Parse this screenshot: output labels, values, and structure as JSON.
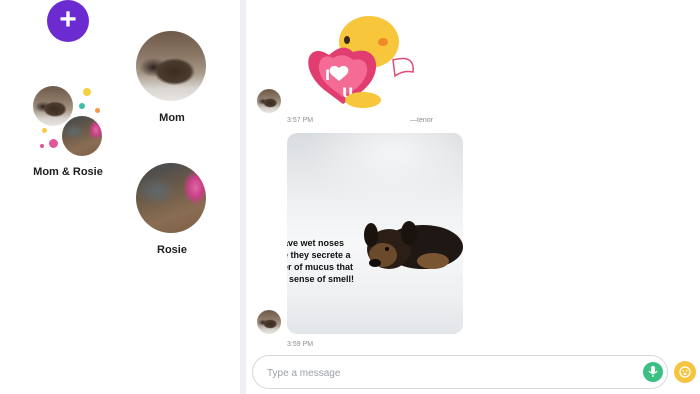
{
  "sidebar": {
    "new_button_icon": "plus-icon",
    "contacts": [
      {
        "name": "Mom"
      },
      {
        "name": "Mom & Rosie"
      },
      {
        "name": "Rosie"
      }
    ]
  },
  "chat": {
    "messages": [
      {
        "type": "sticker",
        "time": "3:57 PM",
        "source": "—tenor"
      },
      {
        "type": "image",
        "time": "3:59 PM",
        "caption": "ave wet noses\ne they secrete a\ner of mucus that\nr sense of smell!"
      }
    ],
    "composer": {
      "placeholder": "Type a message",
      "value": ""
    }
  },
  "colors": {
    "accent": "#6b2bd0",
    "mic": "#3bbf83",
    "emoji": "#f6c440",
    "divider": "#eceef1"
  }
}
